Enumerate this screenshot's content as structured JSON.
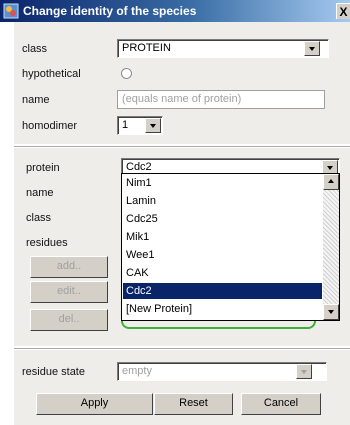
{
  "window": {
    "title": "Change identity of the species",
    "close_glyph": "X"
  },
  "top": {
    "class_label": "class",
    "class_value": "PROTEIN",
    "hypothetical_label": "hypothetical",
    "name_label": "name",
    "name_placeholder": "(equals name of protein)",
    "homodimer_label": "homodimer",
    "homodimer_value": "1"
  },
  "middle": {
    "protein_label": "protein",
    "protein_value": "Cdc2",
    "name_label": "name",
    "class_label": "class",
    "residues_label": "residues",
    "add_label": "add..",
    "edit_label": "edit..",
    "del_label": "del.."
  },
  "dropdown": {
    "items": [
      "Nim1",
      "Lamin",
      "Cdc25",
      "Mik1",
      "Wee1",
      "CAK",
      "Cdc2",
      "[New Protein]"
    ],
    "selected": "Cdc2"
  },
  "bottom": {
    "residue_state_label": "residue state",
    "residue_state_value": "empty",
    "apply_label": "Apply",
    "reset_label": "Reset",
    "cancel_label": "Cancel"
  },
  "colors": {
    "selection": "#0a246a",
    "panel": "#efedea",
    "titlebar": "#0a246a"
  }
}
